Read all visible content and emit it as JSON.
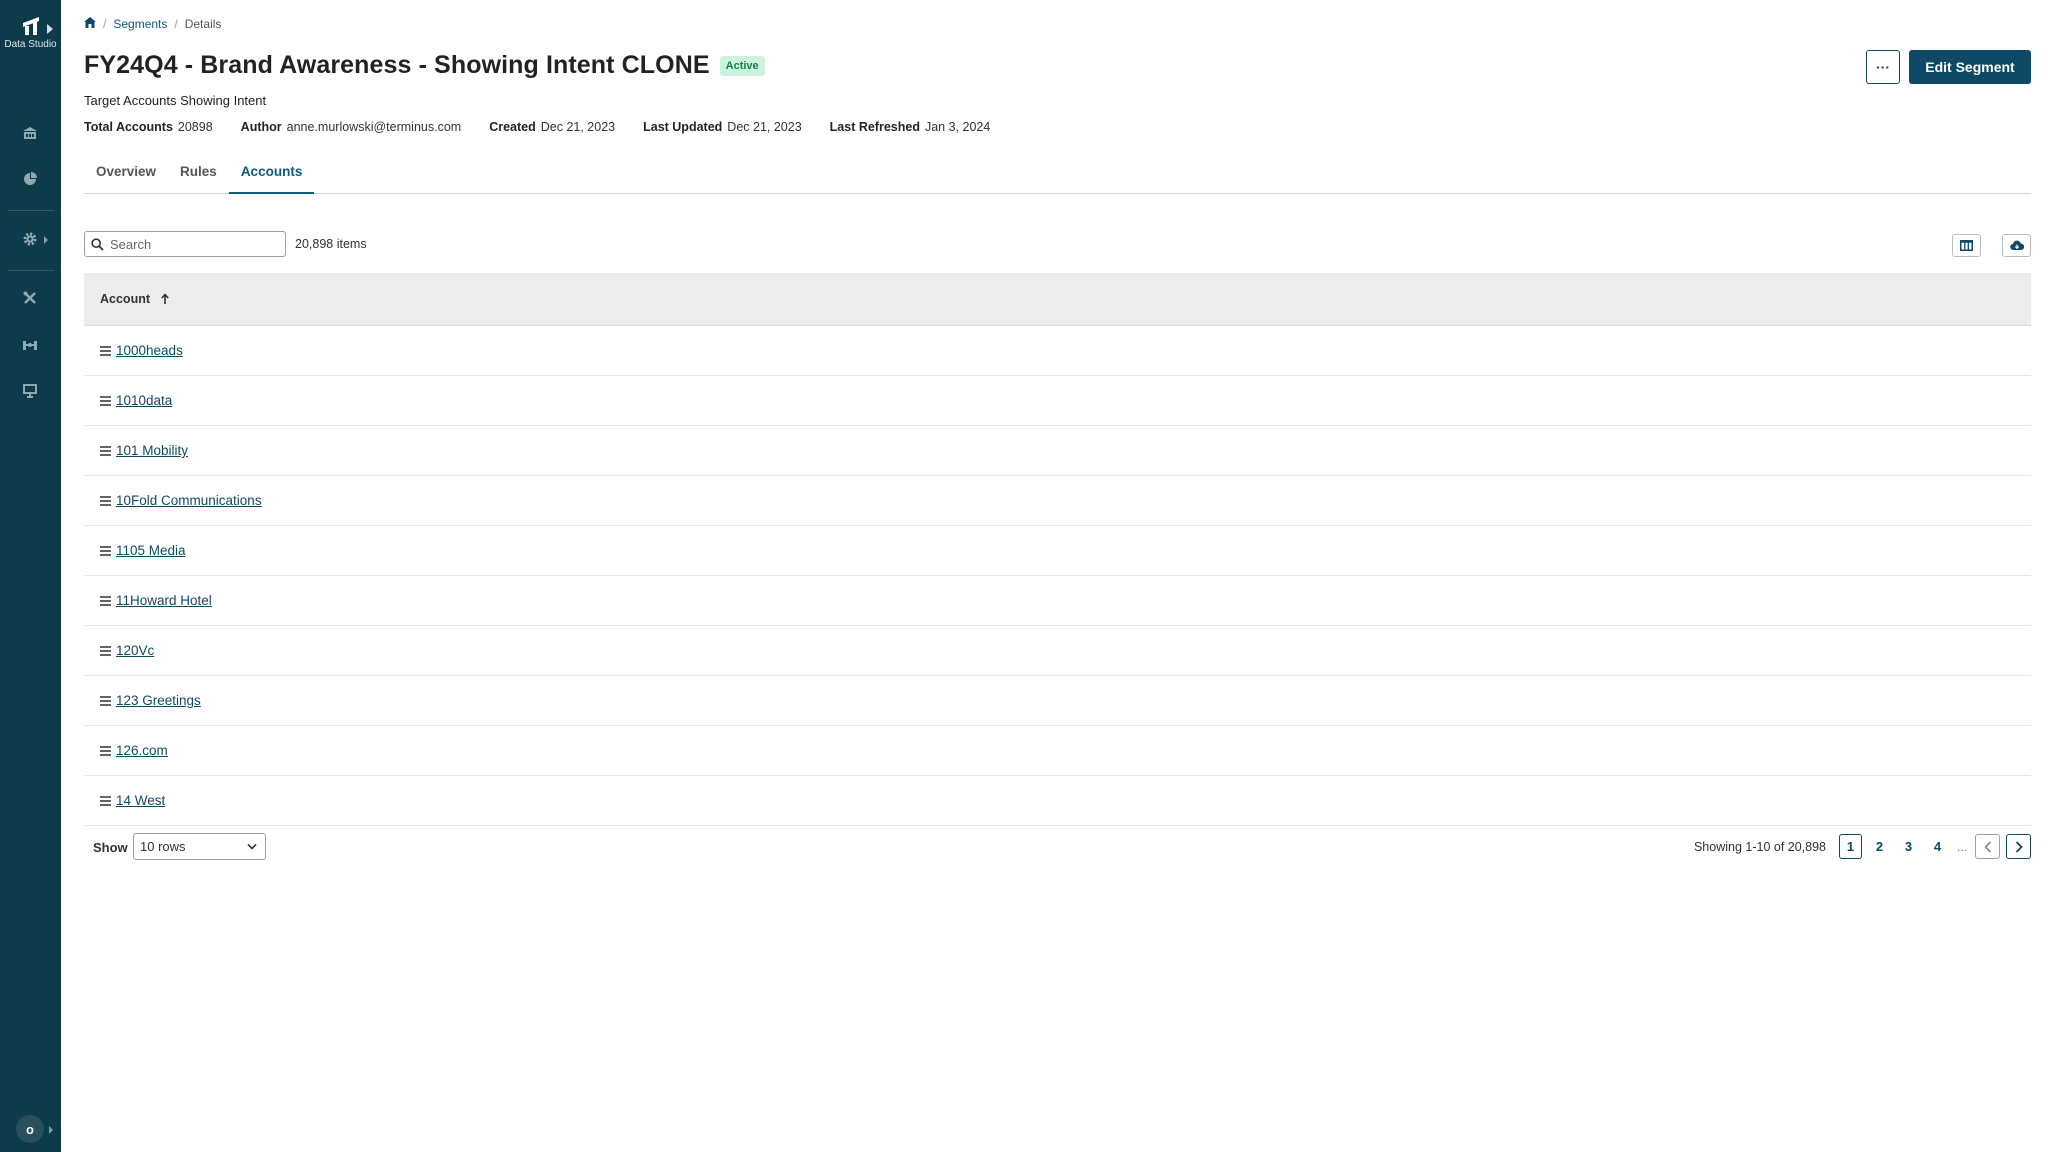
{
  "app": {
    "name": "Data Studio"
  },
  "breadcrumb": {
    "home_icon": "home-icon",
    "segments": "Segments",
    "current": "Details",
    "separator": "/"
  },
  "segment": {
    "title": "FY24Q4 - Brand Awareness - Showing Intent CLONE",
    "status": "Active",
    "description": "Target Accounts Showing Intent",
    "meta": {
      "total_accounts_label": "Total Accounts",
      "total_accounts": "20898",
      "author_label": "Author",
      "author": "anne.murlowski@terminus.com",
      "created_label": "Created",
      "created": "Dec 21, 2023",
      "updated_label": "Last Updated",
      "updated": "Dec 21, 2023",
      "refreshed_label": "Last Refreshed",
      "refreshed": "Jan 3, 2024"
    }
  },
  "actions": {
    "more_label": "···",
    "edit_label": "Edit Segment"
  },
  "tabs": [
    {
      "label": "Overview",
      "active": false
    },
    {
      "label": "Rules",
      "active": false
    },
    {
      "label": "Accounts",
      "active": true
    }
  ],
  "search": {
    "placeholder": "Search",
    "value": "",
    "count": "20,898 items"
  },
  "table": {
    "column": "Account",
    "rows": [
      "1000heads",
      "1010data",
      "101 Mobility",
      "10Fold Communications",
      "1105 Media",
      "11Howard Hotel",
      "120Vc",
      "123 Greetings",
      "126.com",
      "14 West"
    ]
  },
  "pagination": {
    "show_label": "Show",
    "rows_option": "10 rows",
    "summary": "Showing 1-10 of 20,898",
    "pages": [
      "1",
      "2",
      "3",
      "4"
    ],
    "ellipsis": "...",
    "current": "1"
  },
  "user": {
    "initial": "o"
  },
  "colors": {
    "sidebar": "#0d3b4a",
    "accent": "#0e4a66",
    "badge_bg": "#cdf3df",
    "badge_text": "#13804a"
  }
}
